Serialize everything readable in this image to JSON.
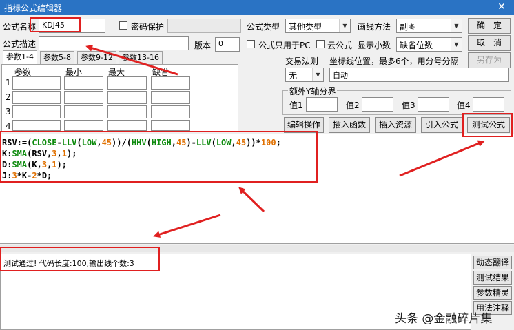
{
  "window": {
    "title": "指标公式编辑器",
    "close_glyph": "✕"
  },
  "form": {
    "name_label": "公式名称",
    "name_value": "KDJ45",
    "password_label": "密码保护",
    "desc_label": "公式描述",
    "desc_value": "",
    "version_label": "版本",
    "version_value": "0",
    "type_label": "公式类型",
    "type_value": "其他类型",
    "draw_label": "画线方法",
    "draw_value": "副图",
    "pc_only_label": "公式只用于PC",
    "cloud_label": "云公式",
    "decimals_label": "显示小数",
    "decimals_value": "缺省位数",
    "trade_rule_label": "交易法则",
    "trade_rule_value": "无",
    "coord_label": "坐标线位置，最多6个，用分号分隔",
    "coord_value": "自动",
    "extra_axis_label": "额外Y轴分界",
    "values": [
      "值1",
      "值2",
      "值3",
      "值4"
    ]
  },
  "buttons": {
    "ok": "确　定",
    "cancel": "取　消",
    "save_as": "另存为",
    "edit_op": "编辑操作",
    "insert_func": "插入函数",
    "insert_res": "插入资源",
    "import_formula": "引入公式",
    "test_formula": "测试公式"
  },
  "param_tabs": [
    "参数1-4",
    "参数5-8",
    "参数9-12",
    "参数13-16"
  ],
  "param_headers": [
    "参数",
    "最小",
    "最大",
    "缺省"
  ],
  "param_rows": [
    "1",
    "2",
    "3",
    "4"
  ],
  "code_lines": [
    "RSV:=(CLOSE-LLV(LOW,45))/(HHV(HIGH,45)-LLV(LOW,45))*100;",
    "K:SMA(RSV,3,1);",
    "D:SMA(K,3,1);",
    "J:3*K-2*D;"
  ],
  "result_text": "测试通过! 代码长度:100,输出线个数:3",
  "side_buttons": [
    "动态翻译",
    "测试结果",
    "参数精灵",
    "用法注释"
  ],
  "watermark": "头条 @金融碎片集",
  "colors": {
    "titlebar": "#2a73c4",
    "annotation_red": "#e02020",
    "keyword_green": "#0c8a0c",
    "number_orange": "#e07000"
  }
}
